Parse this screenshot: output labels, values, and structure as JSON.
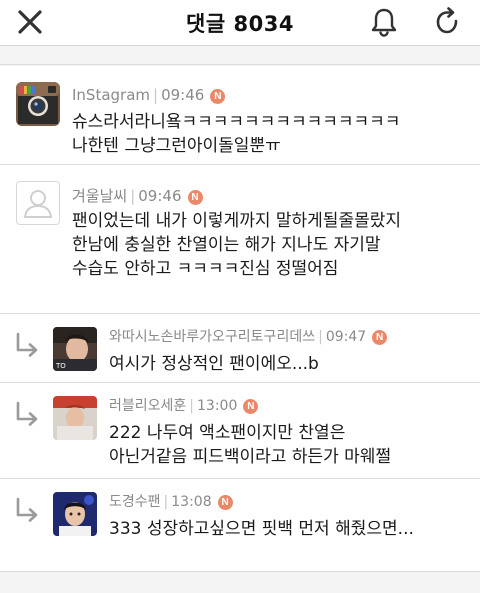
{
  "header": {
    "title": "댓글 8034",
    "close_icon": "close-icon",
    "bell_icon": "bell-icon",
    "refresh_icon": "refresh-icon"
  },
  "comments": [
    {
      "author": "InStagram",
      "time": "09:46",
      "badge": "N",
      "lines": [
        "슈스라서라니욬ㅋㅋㅋㅋㅋㅋㅋㅋㅋㅋㅋㅋㅋㅋ",
        "나한텐 그냥그런아이돌일뿐ㅠ"
      ],
      "avatar": "instagram-logo"
    },
    {
      "author": "겨울날씨",
      "time": "09:46",
      "badge": "N",
      "lines": [
        "팬이었는데 내가 이렇게까지 말하게될줄몰랐지",
        "한남에 충실한 찬열이는 해가 지나도 자기말",
        "수습도 안하고 ㅋㅋㅋㅋ진심 정떨어짐"
      ],
      "avatar": "default-user"
    }
  ],
  "replies": [
    {
      "author": "와따시노손바루가오구리토구리데쓰",
      "time": "09:47",
      "badge": "N",
      "lines": [
        "여시가 정상적인 팬이에오...b"
      ],
      "avatar": "photo-1"
    },
    {
      "author": "러블리오세훈",
      "time": "13:00",
      "badge": "N",
      "lines": [
        "222 나두여 액소팬이지만 찬열은",
        "아닌거같음 피드백이라고 하든가 마웨쩔"
      ],
      "avatar": "photo-2"
    },
    {
      "author": "도경수팬",
      "time": "13:08",
      "badge": "N",
      "lines": [
        "333 성장하고싶으면 핏백 먼저 해줬으면..."
      ],
      "avatar": "photo-3"
    }
  ],
  "colors": {
    "badge": "#e9896a",
    "meta": "#8a8a8a",
    "divider": "#dcdcdc",
    "background": "#f4f4f4"
  }
}
